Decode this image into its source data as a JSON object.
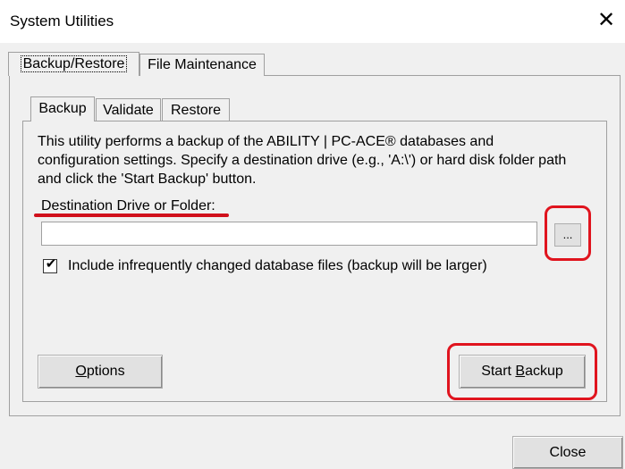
{
  "window": {
    "title": "System Utilities",
    "close_glyph": "✕"
  },
  "outer_tabs": [
    {
      "label": "Backup/Restore",
      "selected": true
    },
    {
      "label": "File Maintenance",
      "selected": false
    }
  ],
  "inner_tabs": [
    {
      "label": "Backup",
      "selected": true
    },
    {
      "label": "Validate",
      "selected": false
    },
    {
      "label": "Restore",
      "selected": false
    }
  ],
  "backup": {
    "description": "This utility performs a backup of the ABILITY | PC-ACE® databases and configuration settings. Specify a destination drive (e.g., 'A:\\') or hard disk folder path and click the 'Start Backup' button.",
    "destination_label": "Destination Drive or Folder:",
    "destination_value": "",
    "browse_label": "...",
    "include_files_label": "Include infrequently changed database files (backup will be larger)",
    "include_files_checked": true,
    "options_button": {
      "mnemonic": "O",
      "rest": "ptions"
    },
    "start_button": {
      "before": "Start ",
      "mnemonic": "B",
      "after": "ackup"
    }
  },
  "footer": {
    "close_label": "Close"
  },
  "colors": {
    "highlight": "#e0141e",
    "panel_bg": "#f0f0f0"
  }
}
